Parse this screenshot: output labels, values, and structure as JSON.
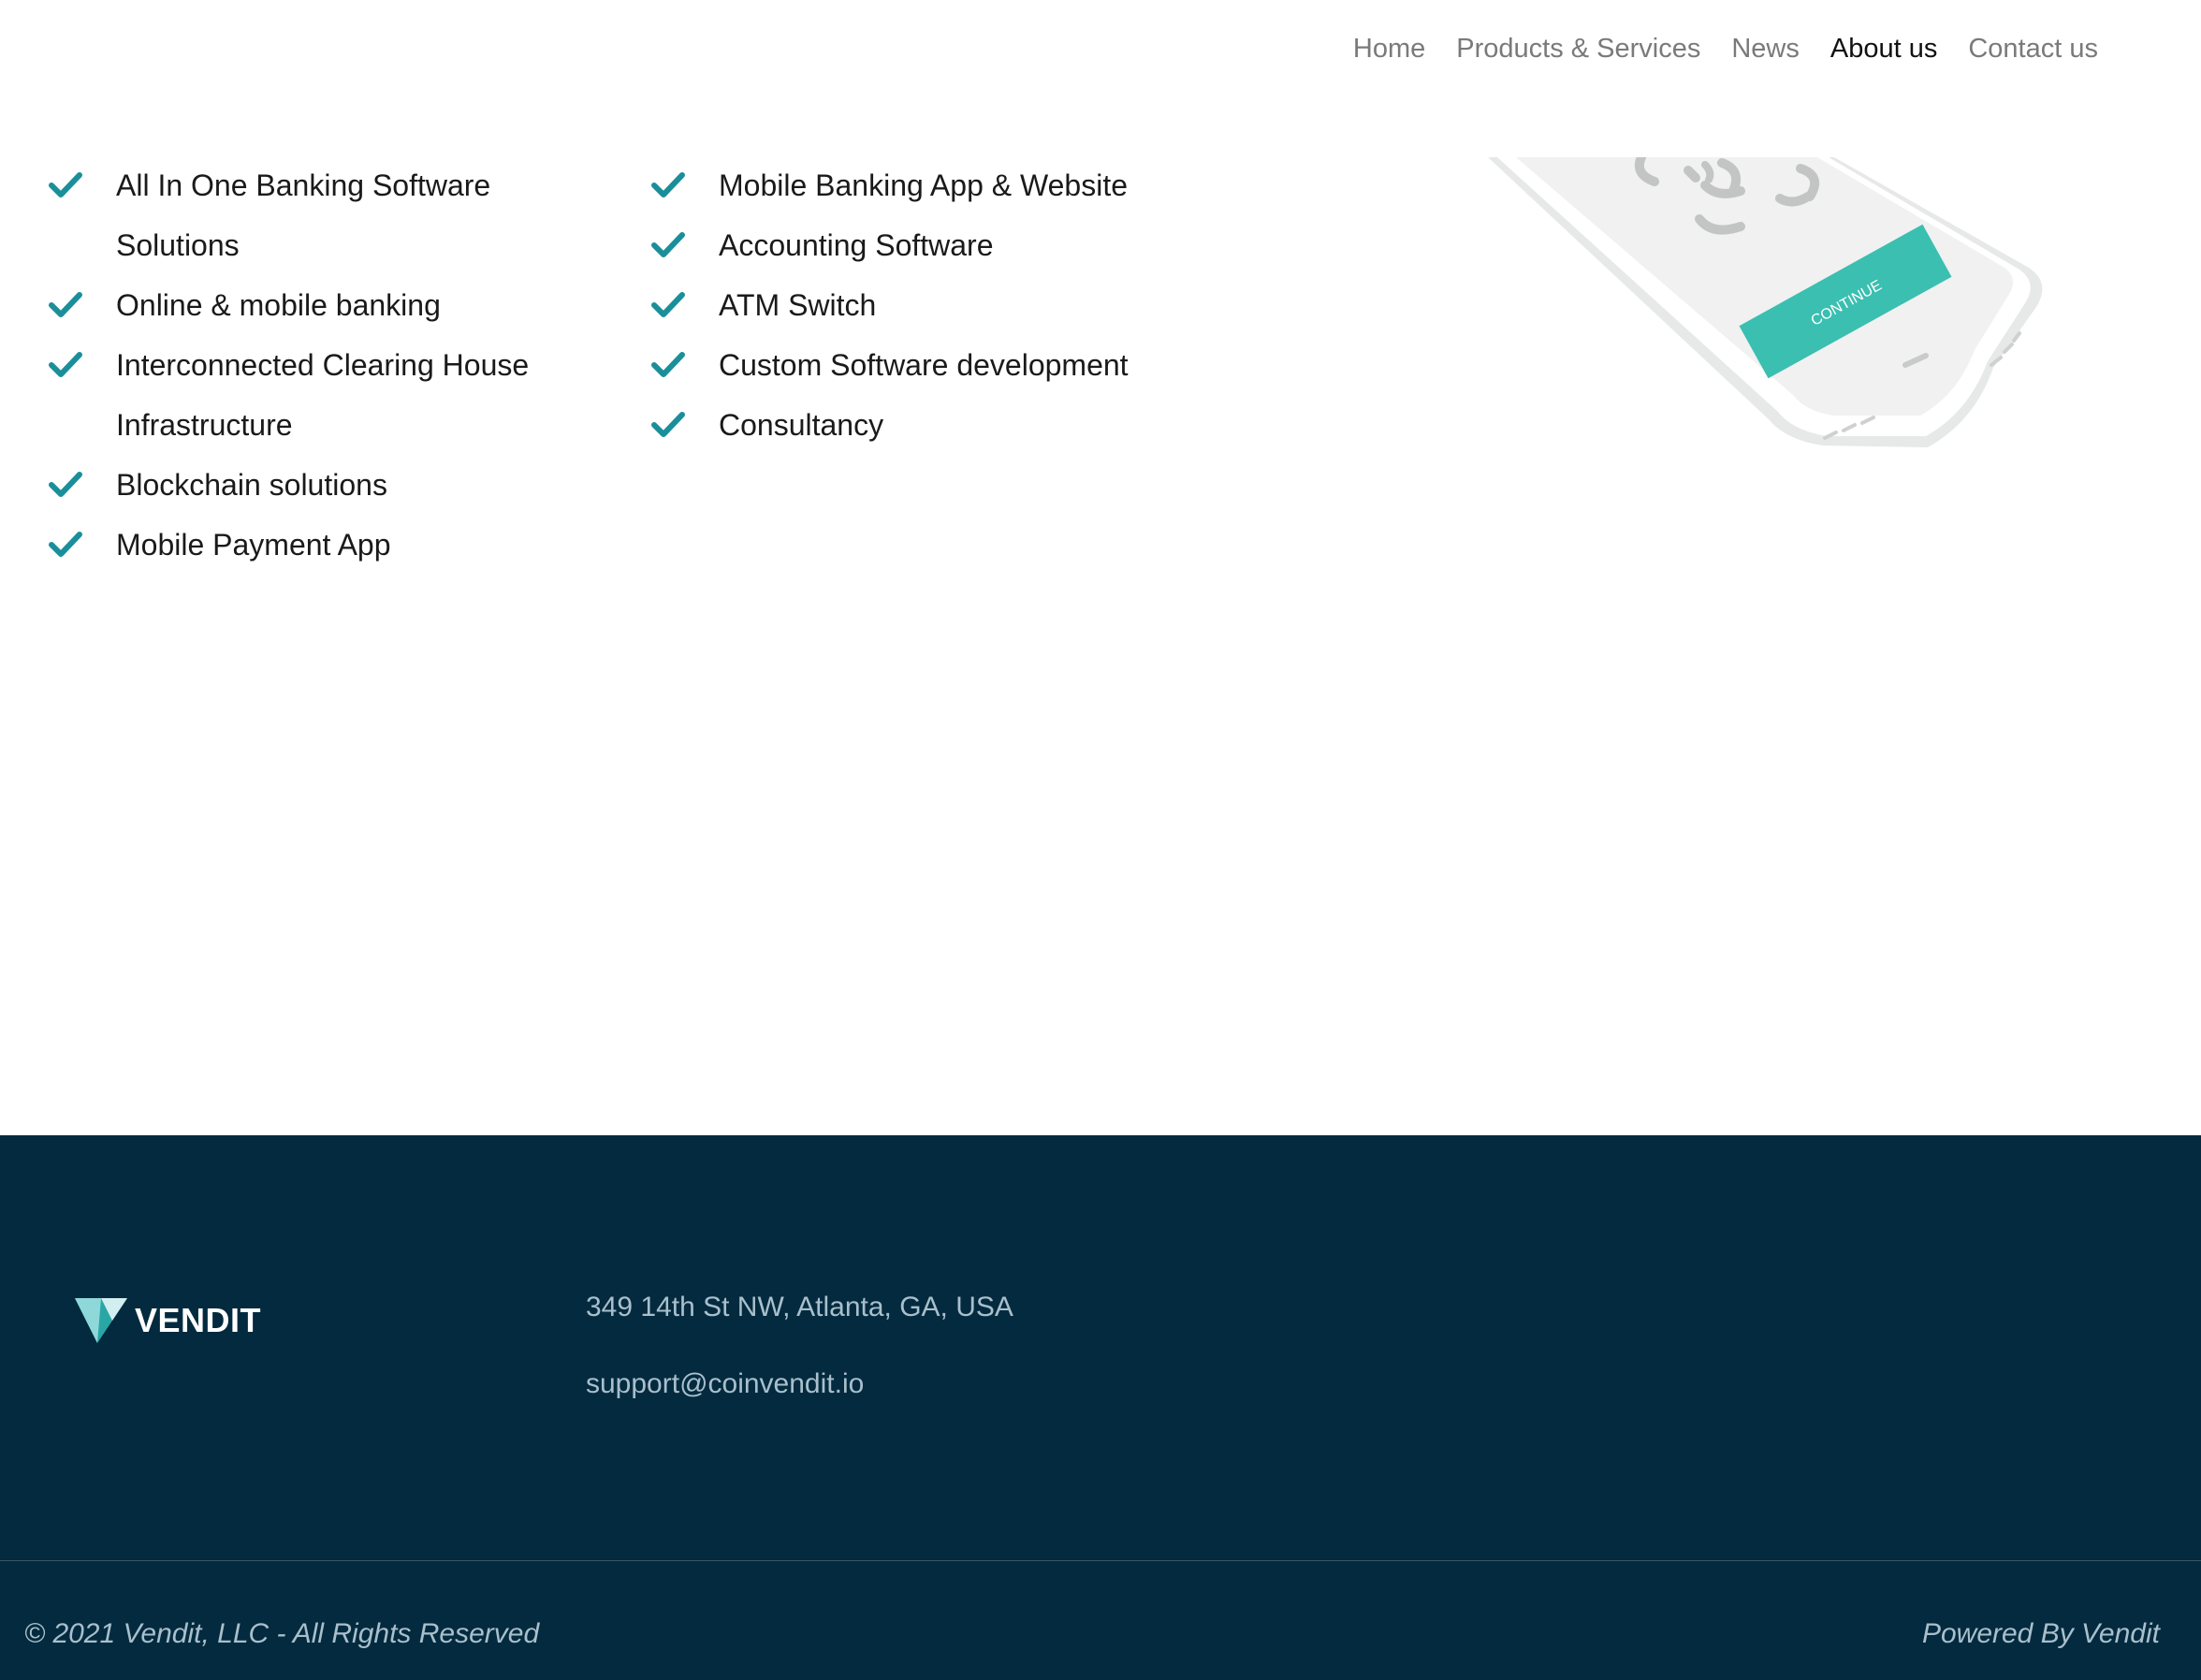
{
  "nav": {
    "items": [
      {
        "label": "Home"
      },
      {
        "label": "Products & Services"
      },
      {
        "label": "News"
      },
      {
        "label": "About us"
      },
      {
        "label": "Contact us"
      }
    ],
    "active_index": 3,
    "active_color": "#111111",
    "inactive_color": "#7a7a7a"
  },
  "features": {
    "check_icon": "checkmark-icon",
    "check_color": "#1a8f9a",
    "column1": [
      "All In One Banking Software Solutions",
      "Online & mobile banking",
      "Interconnected Clearing House Infrastructure",
      "Blockchain solutions",
      "Mobile Payment App"
    ],
    "column2": [
      "Mobile Banking App & Website",
      "Accounting Software",
      "ATM Switch",
      "Custom Software development",
      "Consultancy"
    ]
  },
  "phone_illustration": {
    "button_label": "CONTINUE",
    "button_color": "#3abfb1"
  },
  "footer": {
    "background": "#032a3e",
    "logo_text": "VENDIT",
    "address": "349 14th St NW, Atlanta, GA, USA",
    "email": "support@coinvendit.io",
    "copyright": "© 2021 Vendit, LLC - All Rights Reserved",
    "powered_by": "Powered By Vendit"
  }
}
